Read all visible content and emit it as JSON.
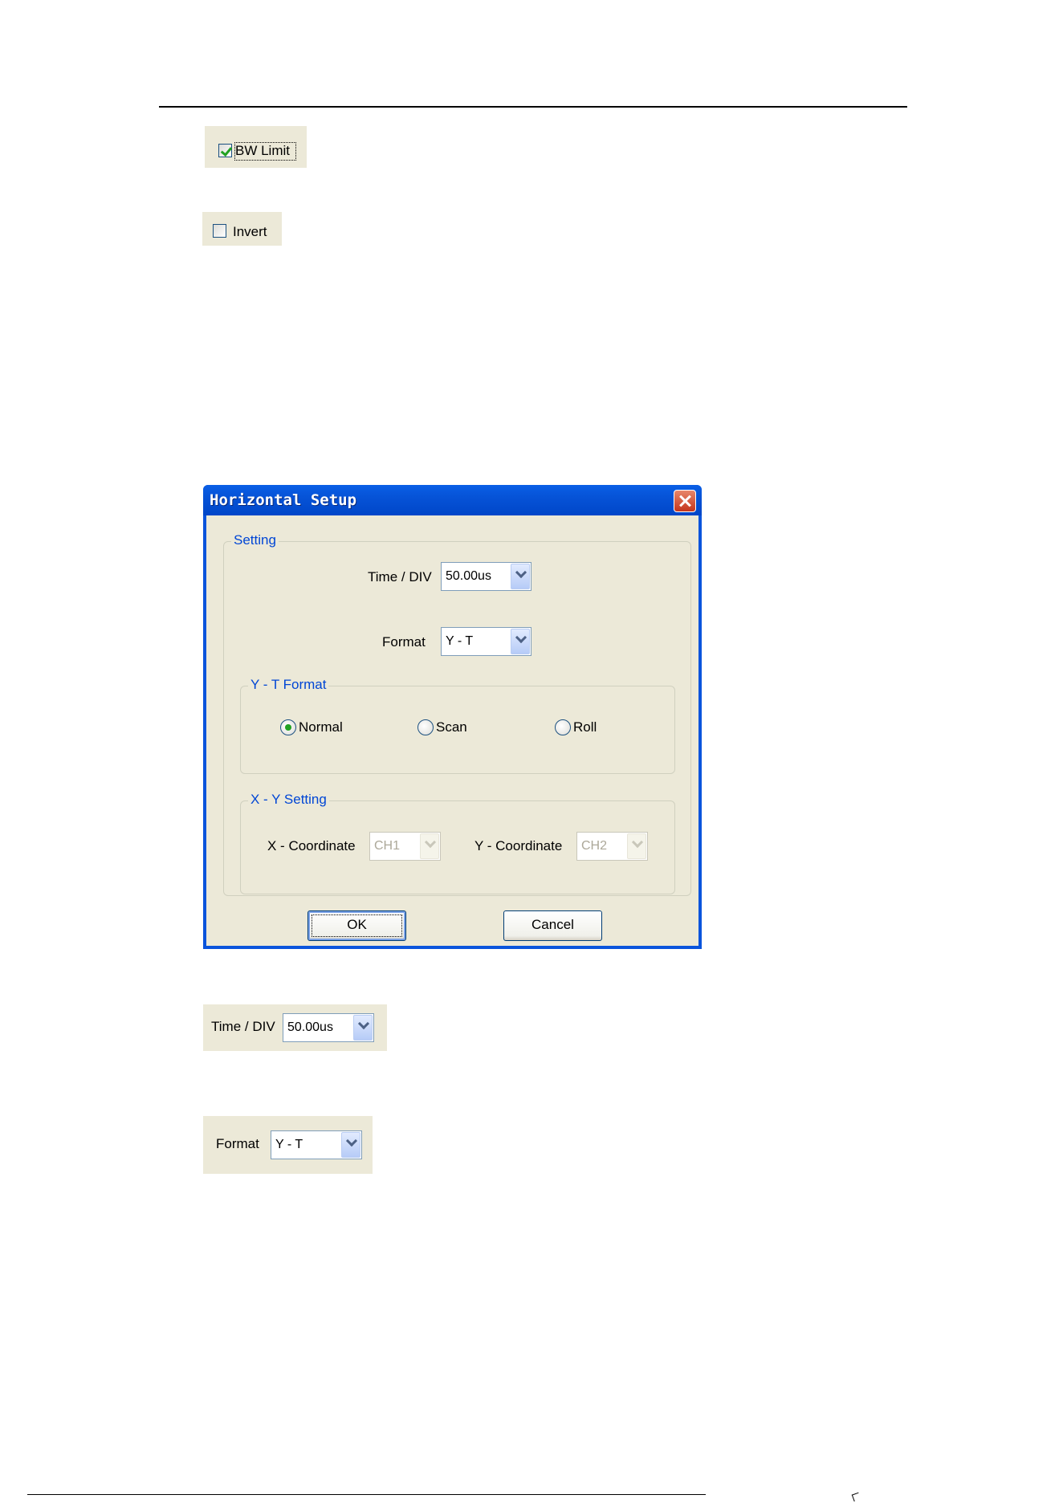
{
  "bw_limit_snippet": {
    "label": "BW Limit",
    "checked": true
  },
  "invert_snippet": {
    "label": "Invert",
    "checked": false
  },
  "dialog": {
    "title": "Horizontal Setup",
    "setting_group": {
      "title": "Setting",
      "time_div_label": "Time / DIV",
      "time_div_value": "50.00us",
      "format_label": "Format",
      "format_value": "Y - T"
    },
    "yt_format_group": {
      "title": "Y - T Format",
      "options": [
        {
          "label": "Normal",
          "selected": true
        },
        {
          "label": "Scan",
          "selected": false
        },
        {
          "label": "Roll",
          "selected": false
        }
      ]
    },
    "xy_setting_group": {
      "title": "X - Y Setting",
      "x_label": "X - Coordinate",
      "x_value": "CH1",
      "y_label": "Y - Coordinate",
      "y_value": "CH2",
      "enabled": false
    },
    "ok_label": "OK",
    "cancel_label": "Cancel"
  },
  "time_div_snippet": {
    "label": "Time / DIV",
    "value": "50.00us"
  },
  "format_snippet": {
    "label": "Format",
    "value": "Y - T"
  }
}
